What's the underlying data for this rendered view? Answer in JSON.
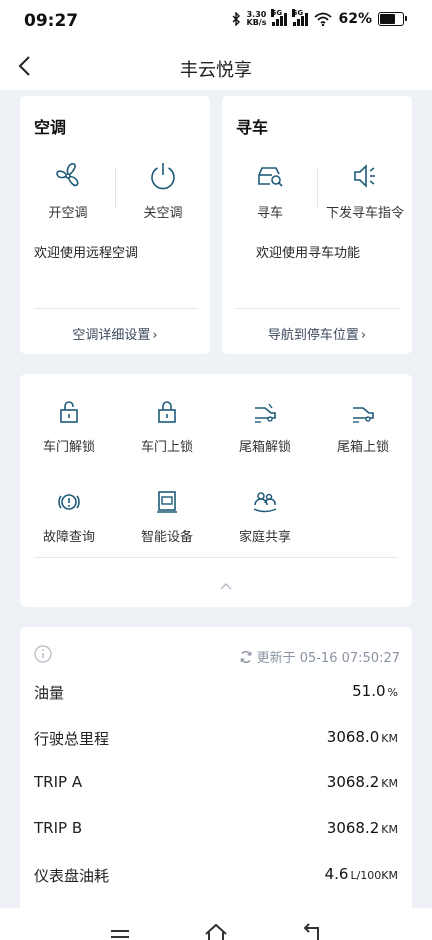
{
  "status": {
    "time": "09:27",
    "net_speed_top": "3.30",
    "net_speed_bottom": "KB/s",
    "sig1": "5G",
    "sig2": "5G",
    "battery": "62%",
    "battery_level": 0.62
  },
  "header": {
    "title": "丰云悦享"
  },
  "ac_card": {
    "title": "空调",
    "on_label": "开空调",
    "off_label": "关空调",
    "welcome": "欢迎使用远程空调",
    "link_label": "空调详细设置"
  },
  "find_card": {
    "title": "寻车",
    "find_label": "寻车",
    "send_label": "下发寻车指令",
    "welcome": "欢迎使用寻车功能",
    "link_label": "导航到停车位置"
  },
  "functions": [
    {
      "label": "车门解锁",
      "icon": "unlock-icon"
    },
    {
      "label": "车门上锁",
      "icon": "lock-icon"
    },
    {
      "label": "尾箱解锁",
      "icon": "trunk-unlock-icon"
    },
    {
      "label": "尾箱上锁",
      "icon": "trunk-lock-icon"
    },
    {
      "label": "故障查询",
      "icon": "fault-icon"
    },
    {
      "label": "智能设备",
      "icon": "smart-device-icon"
    },
    {
      "label": "家庭共享",
      "icon": "family-share-icon"
    }
  ],
  "vehicle": {
    "updated": "更新于 05-16 07:50:27",
    "rows": [
      {
        "label": "油量",
        "value": "51.0",
        "unit": "%"
      },
      {
        "label": "行驶总里程",
        "value": "3068.0",
        "unit": "KM"
      },
      {
        "label": "TRIP A",
        "value": "3068.2",
        "unit": "KM"
      },
      {
        "label": "TRIP B",
        "value": "3068.2",
        "unit": "KM"
      },
      {
        "label": "仪表盘油耗",
        "value": "4.6",
        "unit": "L/100KM"
      }
    ]
  },
  "colors": {
    "accent": "#1f5a7a",
    "background": "#eef2f7"
  }
}
